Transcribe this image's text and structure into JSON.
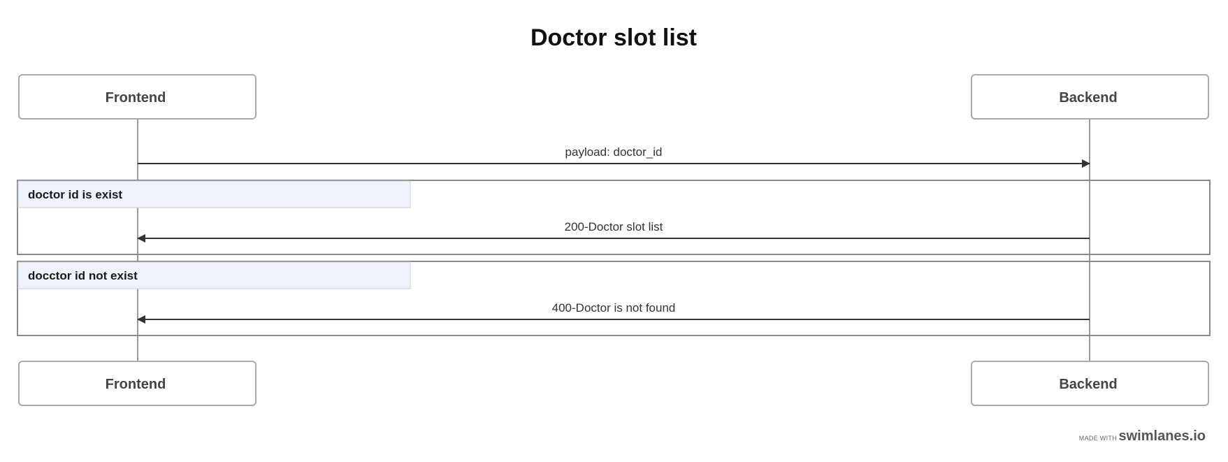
{
  "diagram": {
    "title": "Doctor slot list",
    "actors": {
      "frontend": "Frontend",
      "backend": "Backend"
    },
    "messages": {
      "request": "payload: doctor_id",
      "success": "200-Doctor slot list",
      "failure": "400-Doctor is not found"
    },
    "groups": {
      "exists": "doctor id is exist",
      "not_exists": "docctor id not exist"
    }
  },
  "footer": {
    "made_with": "MADE WITH",
    "brand": "swimlanes.io"
  },
  "colors": {
    "actor_border": "#aaaaaa",
    "lifeline": "#999999",
    "arrow": "#333333",
    "group_border": "#888888",
    "group_label_bg": "#eef2fb",
    "group_label_border": "#c8cdd8"
  }
}
